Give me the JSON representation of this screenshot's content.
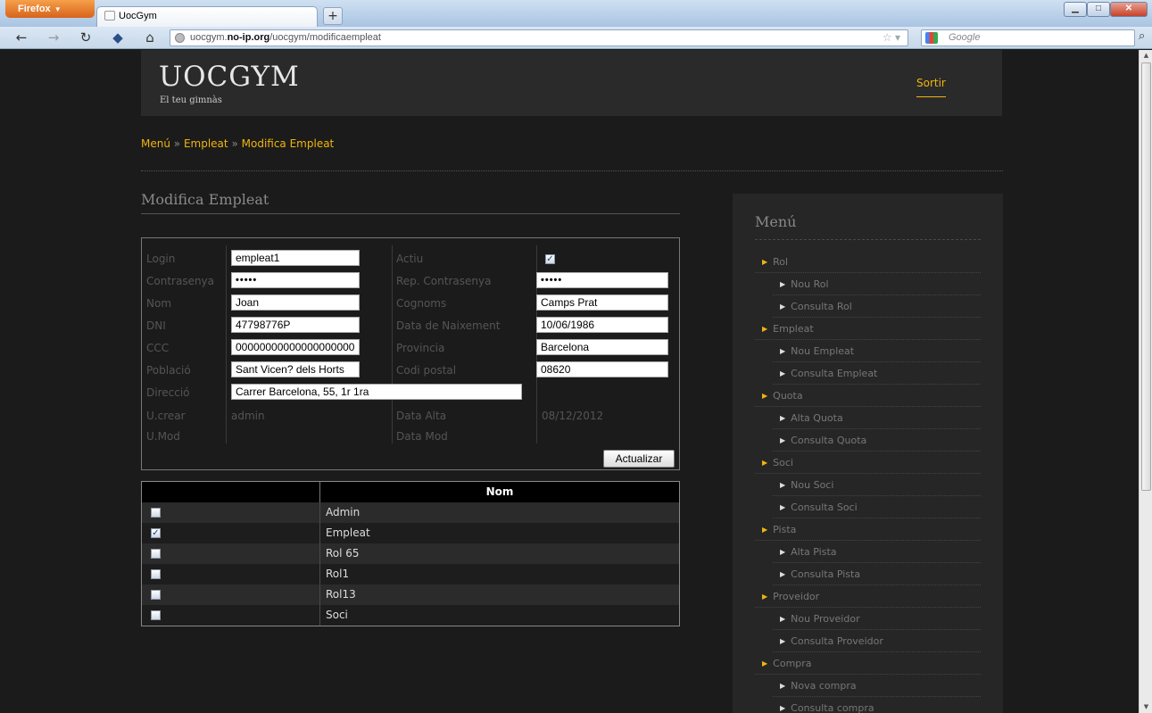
{
  "browser": {
    "app_button": "Firefox",
    "tab_title": "UocGym",
    "new_tab": "+",
    "url_host": "uocgym.",
    "url_bold": "no-ip.org",
    "url_path": "/uocgym/modificaempleat",
    "search_placeholder": "Google",
    "window_controls": [
      "minimize-icon",
      "maximize-icon",
      "close-icon"
    ]
  },
  "header": {
    "logo": "UOCGYM",
    "tagline": "El teu gimnàs",
    "logout": "Sortir"
  },
  "breadcrumb": {
    "items": [
      "Menú",
      "Empleat",
      "Modifica Empleat"
    ],
    "separator": "»"
  },
  "form": {
    "title": "Modifica Empleat",
    "login_label": "Login",
    "login_value": "empleat1",
    "active_label": "Actiu",
    "active_checked": true,
    "password_label": "Contrasenya",
    "password_value": "•••••",
    "repeat_password_label": "Rep. Contrasenya",
    "repeat_password_value": "•••••",
    "name_label": "Nom",
    "name_value": "Joan",
    "surname_label": "Cognoms",
    "surname_value": "Camps Prat",
    "dni_label": "DNI",
    "dni_value": "47798776P",
    "birth_label": "Data de Naixement",
    "birth_value": "10/06/1986",
    "ccc_label": "CCC",
    "ccc_value": "00000000000000000000",
    "province_label": "Provincia",
    "province_value": "Barcelona",
    "town_label": "Població",
    "town_value": "Sant Vicen? dels Horts",
    "postal_label": "Codi postal",
    "postal_value": "08620",
    "address_label": "Direcció",
    "address_value": "Carrer Barcelona, 55, 1r 1ra",
    "created_by_label": "U.crear",
    "created_by_value": "admin",
    "created_date_label": "Data Alta",
    "created_date_value": "08/12/2012",
    "modified_by_label": "U.Mod",
    "modified_date_label": "Data Mod",
    "submit": "Actualizar"
  },
  "roles": {
    "column_header": "Nom",
    "rows": [
      {
        "name": "Admin",
        "checked": false
      },
      {
        "name": "Empleat",
        "checked": true
      },
      {
        "name": "Rol 65",
        "checked": false
      },
      {
        "name": "Rol1",
        "checked": false
      },
      {
        "name": "Rol13",
        "checked": false
      },
      {
        "name": "Soci",
        "checked": false
      }
    ]
  },
  "menu": {
    "title": "Menú",
    "items": [
      {
        "label": "Rol",
        "level": 0
      },
      {
        "label": "Nou Rol",
        "level": 1
      },
      {
        "label": "Consulta Rol",
        "level": 1
      },
      {
        "label": "Empleat",
        "level": 0
      },
      {
        "label": "Nou Empleat",
        "level": 1
      },
      {
        "label": "Consulta Empleat",
        "level": 1
      },
      {
        "label": "Quota",
        "level": 0
      },
      {
        "label": "Alta Quota",
        "level": 1
      },
      {
        "label": "Consulta Quota",
        "level": 1
      },
      {
        "label": "Soci",
        "level": 0
      },
      {
        "label": "Nou Soci",
        "level": 1
      },
      {
        "label": "Consulta Soci",
        "level": 1
      },
      {
        "label": "Pista",
        "level": 0
      },
      {
        "label": "Alta Pista",
        "level": 1
      },
      {
        "label": "Consulta Pista",
        "level": 1
      },
      {
        "label": "Proveidor",
        "level": 0
      },
      {
        "label": "Nou Proveidor",
        "level": 1
      },
      {
        "label": "Consulta Proveidor",
        "level": 1
      },
      {
        "label": "Compra",
        "level": 0
      },
      {
        "label": "Nova compra",
        "level": 1
      },
      {
        "label": "Consulta compra",
        "level": 1
      }
    ]
  },
  "colors": {
    "accent": "#f0b50d",
    "page_bg": "#1b1b1b",
    "header_bg": "#2a2a2a",
    "sidebar_bg": "#262626"
  }
}
